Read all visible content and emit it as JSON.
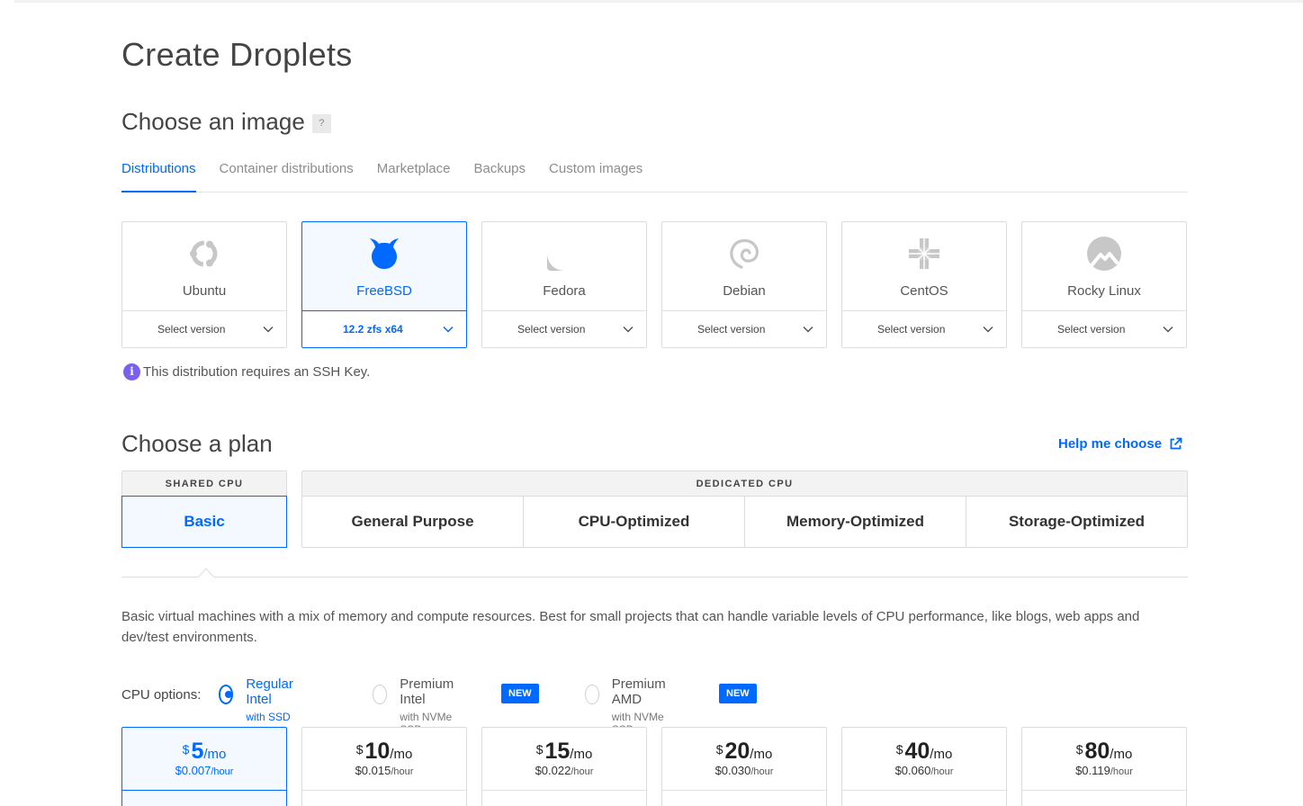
{
  "page": {
    "title": "Create Droplets"
  },
  "image_section": {
    "title": "Choose an image",
    "help": "?",
    "tabs": [
      {
        "label": "Distributions",
        "active": true
      },
      {
        "label": "Container distributions",
        "active": false
      },
      {
        "label": "Marketplace",
        "active": false
      },
      {
        "label": "Backups",
        "active": false
      },
      {
        "label": "Custom images",
        "active": false
      }
    ],
    "distributions": [
      {
        "name": "Ubuntu",
        "version": "Select version",
        "icon": "ubuntu-icon",
        "selected": false
      },
      {
        "name": "FreeBSD",
        "version": "12.2 zfs x64",
        "icon": "freebsd-icon",
        "selected": true
      },
      {
        "name": "Fedora",
        "version": "Select version",
        "icon": "fedora-icon",
        "selected": false
      },
      {
        "name": "Debian",
        "version": "Select version",
        "icon": "debian-icon",
        "selected": false
      },
      {
        "name": "CentOS",
        "version": "Select version",
        "icon": "centos-icon",
        "selected": false
      },
      {
        "name": "Rocky Linux",
        "version": "Select version",
        "icon": "rocky-linux-icon",
        "selected": false
      }
    ],
    "note": "This distribution requires an SSH Key."
  },
  "plan_section": {
    "title": "Choose a plan",
    "help_link": "Help me choose",
    "shared_header": "SHARED CPU",
    "dedicated_header": "DEDICATED CPU",
    "shared_options": [
      {
        "label": "Basic",
        "selected": true
      }
    ],
    "dedicated_options": [
      {
        "label": "General Purpose"
      },
      {
        "label": "CPU-Optimized"
      },
      {
        "label": "Memory-Optimized"
      },
      {
        "label": "Storage-Optimized"
      }
    ],
    "description": "Basic virtual machines with a mix of memory and compute resources. Best for small projects that can handle variable levels of CPU performance, like blogs, web apps and dev/test environments.",
    "cpu_options_label": "CPU options:",
    "cpu_options": [
      {
        "main": "Regular Intel",
        "sub": "with SSD",
        "selected": true,
        "badge": ""
      },
      {
        "main": "Premium Intel",
        "sub": "with NVMe SSD",
        "selected": false,
        "badge": "NEW"
      },
      {
        "main": "Premium AMD",
        "sub": "with NVMe SSD",
        "selected": false,
        "badge": "NEW"
      }
    ],
    "prices": [
      {
        "currency": "$",
        "amount": "5",
        "unit": "/mo",
        "hourly": "$0.007",
        "hourly_unit": "/hour",
        "selected": true
      },
      {
        "currency": "$",
        "amount": "10",
        "unit": "/mo",
        "hourly": "$0.015",
        "hourly_unit": "/hour",
        "selected": false
      },
      {
        "currency": "$",
        "amount": "15",
        "unit": "/mo",
        "hourly": "$0.022",
        "hourly_unit": "/hour",
        "selected": false
      },
      {
        "currency": "$",
        "amount": "20",
        "unit": "/mo",
        "hourly": "$0.030",
        "hourly_unit": "/hour",
        "selected": false
      },
      {
        "currency": "$",
        "amount": "40",
        "unit": "/mo",
        "hourly": "$0.060",
        "hourly_unit": "/hour",
        "selected": false
      },
      {
        "currency": "$",
        "amount": "80",
        "unit": "/mo",
        "hourly": "$0.119",
        "hourly_unit": "/hour",
        "selected": false
      }
    ]
  },
  "colors": {
    "accent": "#0069ff",
    "info": "#7b5ff0",
    "selected_bg": "#f4f8ff",
    "border": "#dcdcdc"
  }
}
